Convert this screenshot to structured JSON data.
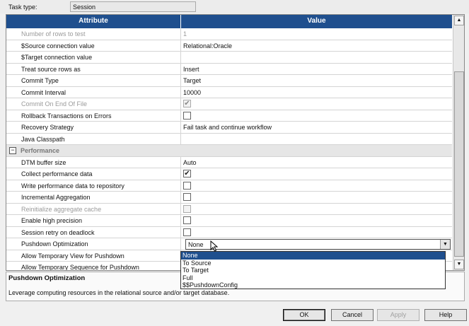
{
  "task_type": {
    "label": "Task type:",
    "value": "Session"
  },
  "grid": {
    "headers": {
      "attribute": "Attribute",
      "value": "Value"
    },
    "rows": [
      {
        "attr": "Number of rows to test",
        "value": "1",
        "disabled": true
      },
      {
        "attr": "$Source connection value",
        "value": "Relational:Oracle"
      },
      {
        "attr": "$Target connection value",
        "value": ""
      },
      {
        "attr": "Treat source rows as",
        "value": "Insert"
      },
      {
        "attr": "Commit Type",
        "value": "Target"
      },
      {
        "attr": "Commit Interval",
        "value": "10000"
      },
      {
        "attr": "Commit On End Of File",
        "checked": true,
        "disabled": true
      },
      {
        "attr": "Rollback Transactions on Errors",
        "checked": false
      },
      {
        "attr": "Recovery Strategy",
        "value": "Fail task and continue workflow"
      },
      {
        "attr": "Java Classpath",
        "value": ""
      },
      {
        "section": "Performance",
        "expander": "−"
      },
      {
        "attr": "DTM buffer size",
        "value": "Auto"
      },
      {
        "attr": "Collect performance data",
        "checked": true
      },
      {
        "attr": "Write performance data to repository",
        "checked": false
      },
      {
        "attr": "Incremental Aggregation",
        "checked": false
      },
      {
        "attr": "Reinitialize aggregate cache",
        "checked": false,
        "disabled": true
      },
      {
        "attr": "Enable high precision",
        "checked": false
      },
      {
        "attr": "Session retry on deadlock",
        "checked": false
      },
      {
        "attr": "Pushdown Optimization",
        "combo": "None"
      },
      {
        "attr": "Allow Temporary View for Pushdown",
        "value": ""
      },
      {
        "attr": "Allow Temporary Sequence for Pushdown",
        "value": ""
      }
    ]
  },
  "dropdown": {
    "options": [
      "None",
      "To Source",
      "To Target",
      "Full",
      "$$PushdownConfig"
    ],
    "selected": "None"
  },
  "description": {
    "title": "Pushdown Optimization",
    "text": "Leverage computing resources in the relational source and/or target database."
  },
  "buttons": {
    "ok": "OK",
    "cancel": "Cancel",
    "apply": "Apply",
    "help": "Help"
  },
  "icons": {
    "dropdown_arrow": "▼",
    "scroll_up": "▲",
    "scroll_down": "▼",
    "check": "✔"
  }
}
